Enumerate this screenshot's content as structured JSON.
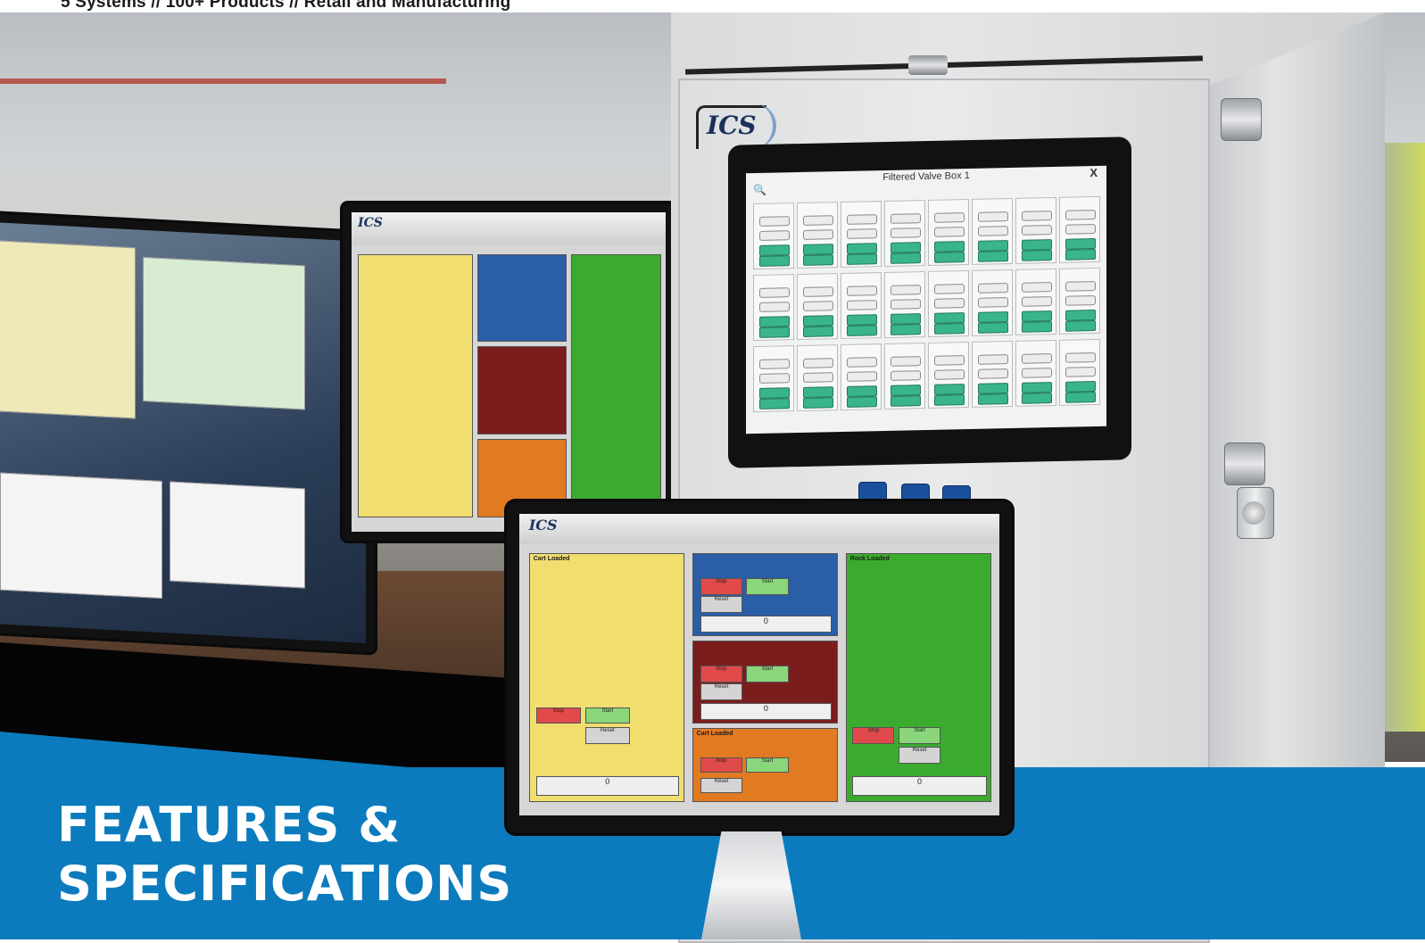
{
  "header": {
    "tagline": "5 Systems  //  100+ Products  //  Retail and Manufacturing"
  },
  "hero": {
    "headline_line1": "FEATURES &",
    "headline_line2": "SPECIFICATIONS"
  },
  "enclosure": {
    "logo_text": "ICS",
    "touchscreen": {
      "title": "Filtered Valve Box 1",
      "close_glyph": "X",
      "search_glyph": "🔍",
      "brand": "",
      "columns": 8,
      "rows": 3
    }
  },
  "front_monitor": {
    "logo_text": "ICS",
    "tiles": {
      "yellow_title": "Cart Loaded",
      "green_title": "Rock Loaded",
      "orange_title": "Cart Loaded",
      "yellow_counter": "0",
      "blue_counter": "0",
      "red_counter": "0",
      "green_counter": "0"
    },
    "buttons": {
      "stop": "Stop",
      "start": "Start",
      "reset": "Reset"
    }
  },
  "middle_monitor": {
    "logo_text": "ICS"
  },
  "colors": {
    "blue_band": "#0b7bbd",
    "headline": "#ffffff",
    "hmi_yellow": "#f1de6f",
    "hmi_blue": "#2a5fa8",
    "hmi_red": "#7c1d1d",
    "hmi_green": "#3bab2f",
    "hmi_orange": "#e27a22",
    "control_button_blue": "#1a4f9c"
  }
}
